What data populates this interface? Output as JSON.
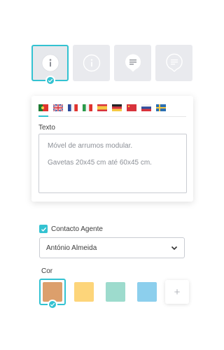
{
  "icon_tiles": [
    {
      "icon": "info-icon",
      "style": "filled",
      "selected": true
    },
    {
      "icon": "info-outline-icon",
      "style": "outline",
      "selected": false
    },
    {
      "icon": "speech-bubble-icon",
      "style": "filled",
      "selected": false
    },
    {
      "icon": "speech-bubble-outline-icon",
      "style": "outline",
      "selected": false
    }
  ],
  "languages": [
    {
      "flag": "portugal-flag-icon",
      "active": true
    },
    {
      "flag": "uk-flag-icon",
      "active": false
    },
    {
      "flag": "france-flag-icon",
      "active": false
    },
    {
      "flag": "italy-flag-icon",
      "active": false
    },
    {
      "flag": "spain-flag-icon",
      "active": false
    },
    {
      "flag": "germany-flag-icon",
      "active": false
    },
    {
      "flag": "china-flag-icon",
      "active": false
    },
    {
      "flag": "russia-flag-icon",
      "active": false
    },
    {
      "flag": "sweden-flag-icon",
      "active": false
    }
  ],
  "text_field": {
    "label": "Texto",
    "line1": "Móvel de arrumos modular.",
    "line2": "Gavetas 20x45 cm até 60x45 cm."
  },
  "agent": {
    "checkbox_label": "Contacto Agente",
    "checked": true,
    "selected_agent": "António Almeida"
  },
  "color": {
    "label": "Cor",
    "add_label": "+",
    "swatches": [
      {
        "hex": "#dc9f6c",
        "selected": true
      },
      {
        "hex": "#fdd57a",
        "selected": false
      },
      {
        "hex": "#9ddbcd",
        "selected": false
      },
      {
        "hex": "#8ccfed",
        "selected": false
      }
    ]
  },
  "accent": "#33c2d1"
}
